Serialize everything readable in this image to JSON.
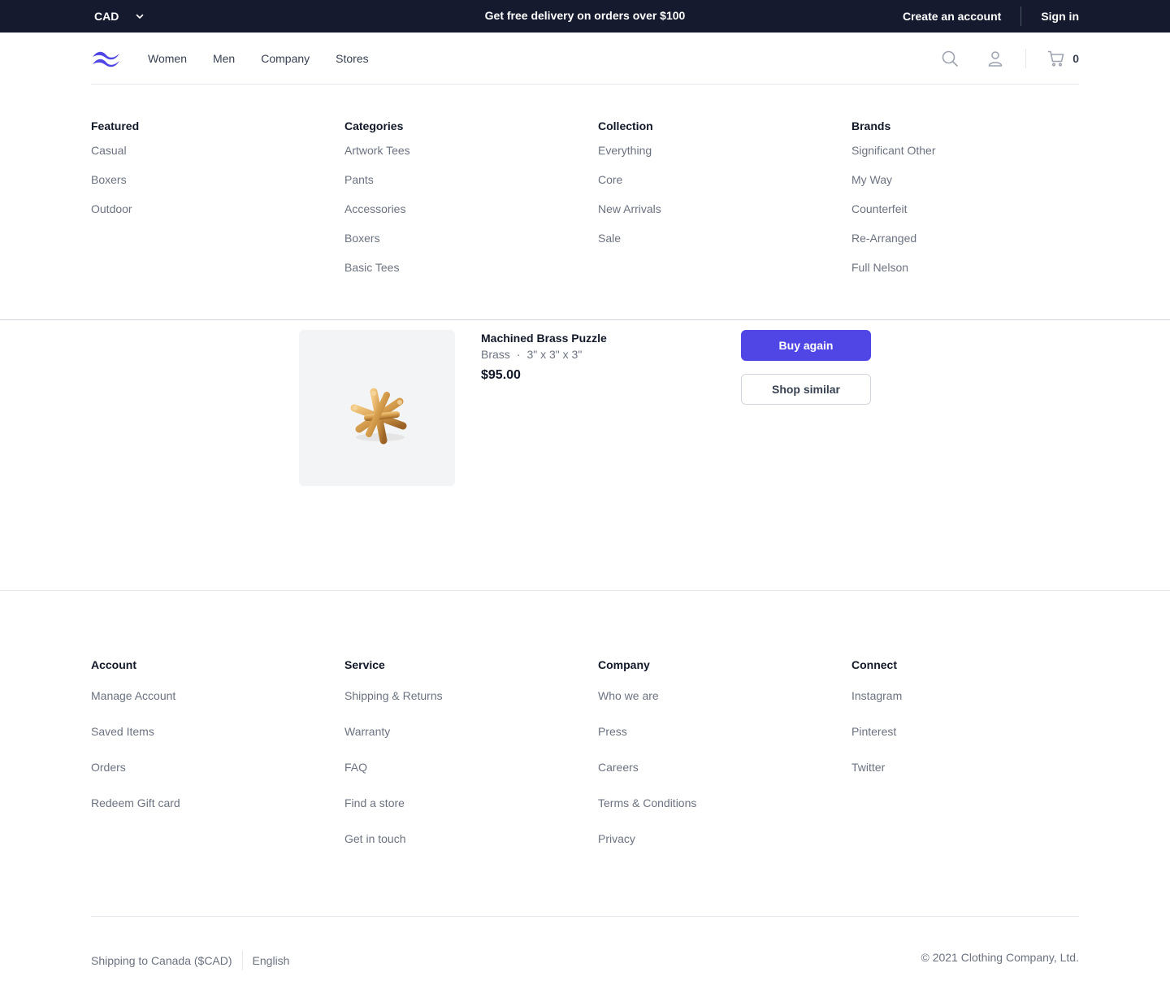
{
  "topbar": {
    "currency": "CAD",
    "promo": "Get free delivery on orders over $100",
    "create_account": "Create an account",
    "sign_in": "Sign in"
  },
  "nav": {
    "links": [
      "Women",
      "Men",
      "Company",
      "Stores"
    ],
    "cart_count": "0",
    "brand_color": "#4f46e5"
  },
  "mega_menu": {
    "columns": [
      {
        "title": "Featured",
        "items": [
          "Casual",
          "Boxers",
          "Outdoor"
        ]
      },
      {
        "title": "Categories",
        "items": [
          "Artwork Tees",
          "Pants",
          "Accessories",
          "Boxers",
          "Basic Tees"
        ]
      },
      {
        "title": "Collection",
        "items": [
          "Everything",
          "Core",
          "New Arrivals",
          "Sale"
        ]
      },
      {
        "title": "Brands",
        "items": [
          "Significant Other",
          "My Way",
          "Counterfeit",
          "Re-Arranged",
          "Full Nelson"
        ]
      }
    ]
  },
  "product": {
    "name": "Machined Brass Puzzle",
    "material": "Brass",
    "separator": "·",
    "dimensions": "3\" x 3\" x 3\"",
    "price": "$95.00",
    "buy_again": "Buy again",
    "shop_similar": "Shop similar"
  },
  "footer": {
    "columns": [
      {
        "title": "Account",
        "items": [
          "Manage Account",
          "Saved Items",
          "Orders",
          "Redeem Gift card"
        ]
      },
      {
        "title": "Service",
        "items": [
          "Shipping & Returns",
          "Warranty",
          "FAQ",
          "Find a store",
          "Get in touch"
        ]
      },
      {
        "title": "Company",
        "items": [
          "Who we are",
          "Press",
          "Careers",
          "Terms & Conditions",
          "Privacy"
        ]
      },
      {
        "title": "Connect",
        "items": [
          "Instagram",
          "Pinterest",
          "Twitter"
        ]
      }
    ],
    "shipping": "Shipping to Canada ($CAD)",
    "language": "English",
    "copyright": "© 2021 Clothing Company, Ltd."
  }
}
